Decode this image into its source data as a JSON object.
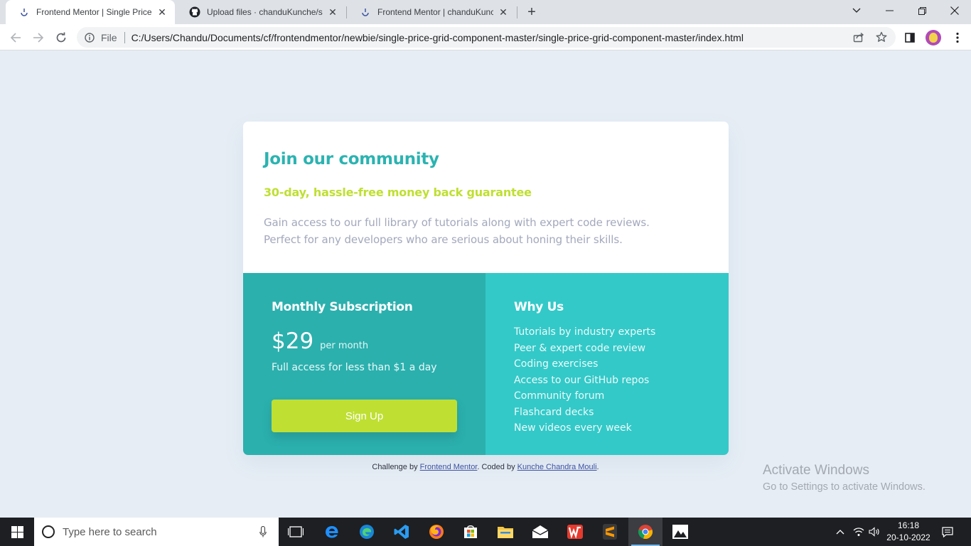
{
  "browser": {
    "tabs": [
      {
        "title": "Frontend Mentor | Single Price G",
        "active": true,
        "icon": "frontend-mentor-favicon"
      },
      {
        "title": "Upload files · chanduKunche/sing",
        "active": false,
        "icon": "github-favicon"
      },
      {
        "title": "Frontend Mentor | chanduKunche",
        "active": false,
        "icon": "frontend-mentor-favicon"
      }
    ],
    "address": {
      "scheme_label": "File",
      "url": "C:/Users/Chandu/Documents/cf/frontendmentor/newbie/single-price-grid-component-master/single-price-grid-component-master/index.html"
    }
  },
  "page": {
    "community": {
      "heading": "Join our community",
      "subheading": "30-day, hassle-free money back guarantee",
      "description": "Gain access to our full library of tutorials along with expert code reviews. Perfect for any developers who are serious about honing their skills."
    },
    "subscription": {
      "title": "Monthly Subscription",
      "price": "$29",
      "period": "per month",
      "note": "Full access for less than $1 a day",
      "button_label": "Sign Up"
    },
    "why_us": {
      "title": "Why Us",
      "items": [
        "Tutorials by industry experts",
        "Peer & expert code review",
        "Coding exercises",
        "Access to our GitHub repos",
        "Community forum",
        "Flashcard decks",
        "New videos every week"
      ]
    },
    "attribution": {
      "prefix": "Challenge by ",
      "link1": "Frontend Mentor",
      "middle": ". Coded by ",
      "link2": "Kunche Chandra Mouli",
      "suffix": "."
    }
  },
  "watermark": {
    "line1": "Activate Windows",
    "line2": "Go to Settings to activate Windows."
  },
  "taskbar": {
    "search_placeholder": "Type here to search",
    "time": "16:18",
    "date": "20-10-2022"
  },
  "colors": {
    "primary_cyan": "#2bb3b1",
    "accent_lime": "#bfdf33",
    "panel_dark": "#2bb0ae",
    "panel_light": "#33c9c8",
    "page_background": "#e6edf5"
  }
}
